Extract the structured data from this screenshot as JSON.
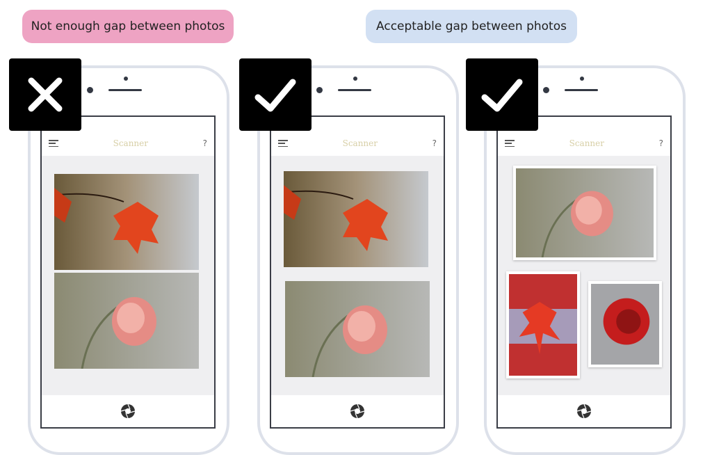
{
  "labels": {
    "bad": "Not enough gap between photos",
    "good": "Acceptable gap between photos"
  },
  "phones": [
    {
      "verdict": "x-icon",
      "app_title": "Scanner",
      "help": "?",
      "photos": [
        "maple-leaf-raindrops",
        "frosted-rosebud"
      ]
    },
    {
      "verdict": "check-icon",
      "app_title": "Scanner",
      "help": "?",
      "photos": [
        "maple-leaf-raindrops",
        "frosted-rosebud"
      ]
    },
    {
      "verdict": "check-icon",
      "app_title": "Scanner",
      "help": "?",
      "photos": [
        "frosted-rosebud",
        "red-maple-leaf",
        "red-rose"
      ]
    }
  ],
  "colors": {
    "bad_pill": "#eea3c3",
    "good_pill": "#d2e0f3",
    "title": "#d7cfa6"
  }
}
